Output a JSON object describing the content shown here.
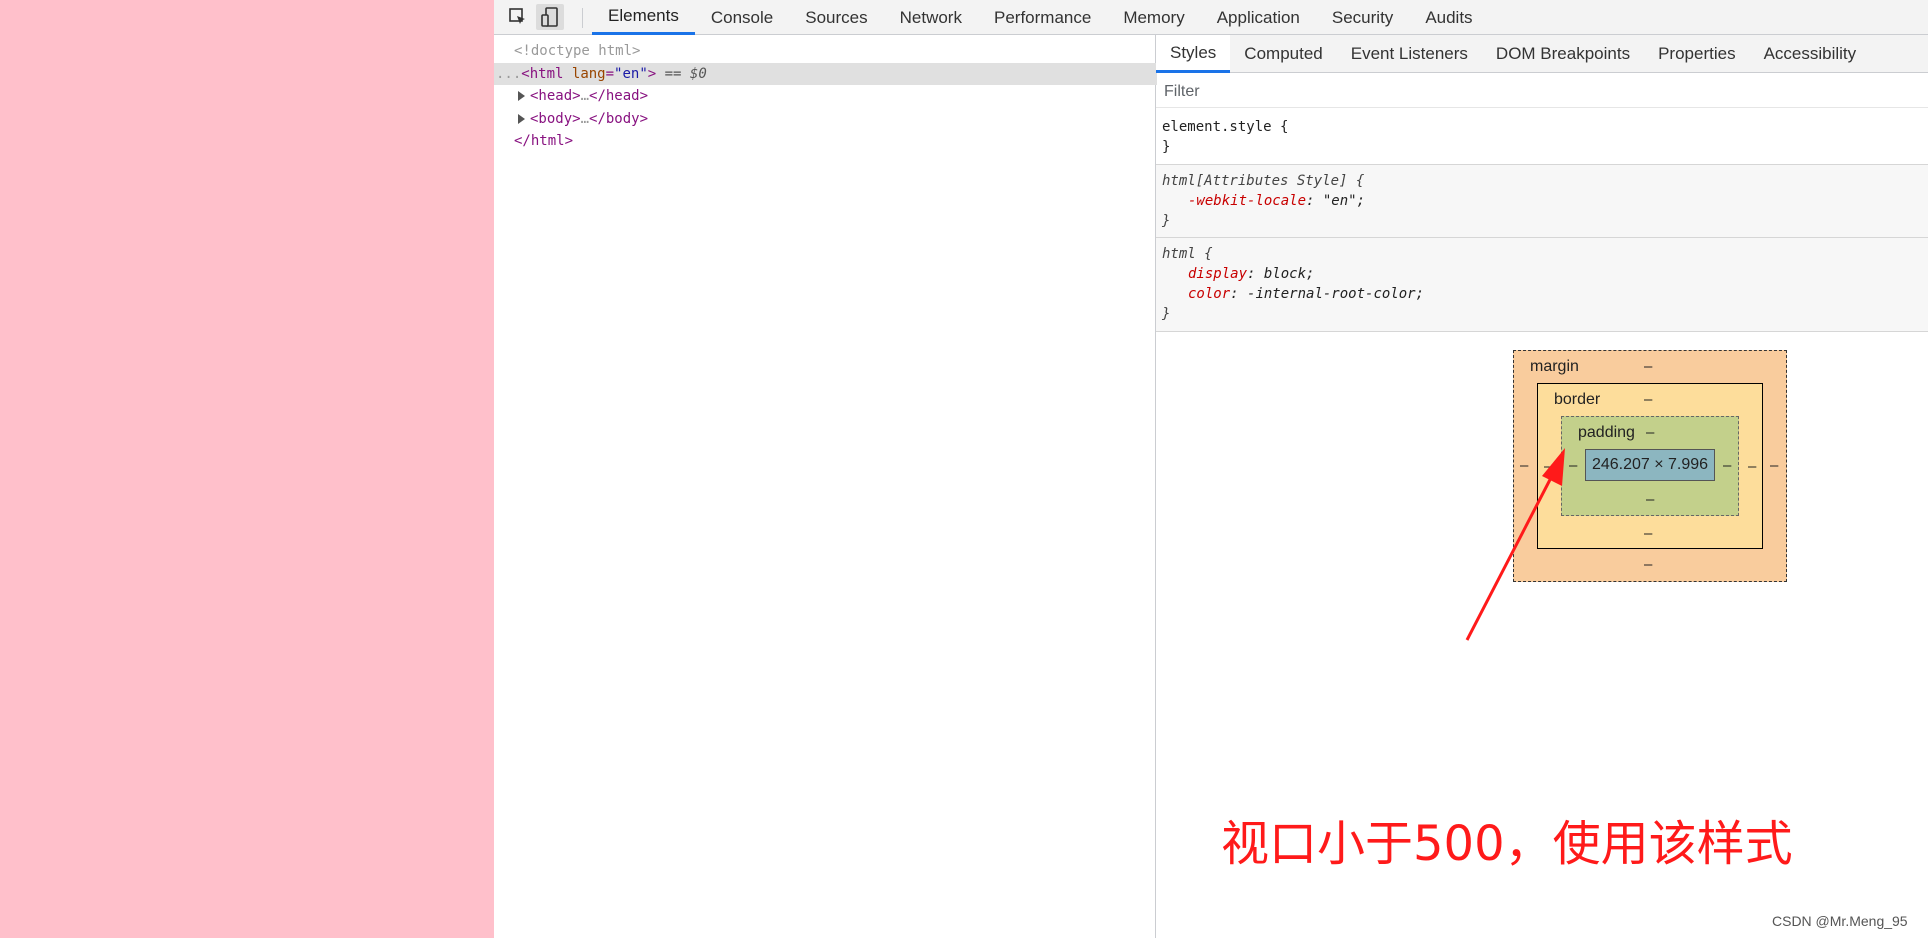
{
  "toolbar": {
    "inspect_icon": "inspect-element-icon",
    "device_icon": "device-toolbar-icon",
    "tabs": [
      {
        "label": "Elements",
        "active": true
      },
      {
        "label": "Console"
      },
      {
        "label": "Sources"
      },
      {
        "label": "Network"
      },
      {
        "label": "Performance"
      },
      {
        "label": "Memory"
      },
      {
        "label": "Application"
      },
      {
        "label": "Security"
      },
      {
        "label": "Audits"
      }
    ]
  },
  "elements": {
    "doctype": "<!doctype html>",
    "html_open_prefix": "...",
    "html_tag_open": "<html",
    "html_attr_name": "lang",
    "html_attr_eq": "=",
    "html_attr_value": "\"en\"",
    "html_tag_close": ">",
    "html_selected_marker": " == $0",
    "head_open": "<head>",
    "head_ellipsis": "…",
    "head_close": "</head>",
    "body_open": "<body>",
    "body_ellipsis": "…",
    "body_close": "</body>",
    "html_end": "</html>"
  },
  "styles": {
    "sub_tabs": [
      {
        "label": "Styles",
        "active": true
      },
      {
        "label": "Computed"
      },
      {
        "label": "Event Listeners"
      },
      {
        "label": "DOM Breakpoints"
      },
      {
        "label": "Properties"
      },
      {
        "label": "Accessibility"
      }
    ],
    "filter_placeholder": "Filter",
    "rules": {
      "element_style_open": "element.style {",
      "element_style_close": "}",
      "attr_selector": "html[Attributes Style] {",
      "attr_prop": "-webkit-locale",
      "attr_value": "\"en\";",
      "attr_close": "}",
      "html_selector": "html {",
      "prop_display": "display",
      "value_display": "block;",
      "prop_color": "color",
      "value_color": "-internal-root-color;",
      "html_close": "}"
    }
  },
  "box_model": {
    "margin_label": "margin",
    "border_label": "border",
    "padding_label": "padding",
    "dash": "–",
    "content_size": "246.207 × 7.996"
  },
  "annotation": {
    "text": "视口小于500，使用该样式",
    "color": "#ff1a1a"
  },
  "watermark": "CSDN @Mr.Meng_95",
  "colors": {
    "viewport_bg": "#ffc0cb",
    "active_tab": "#1a73e8",
    "margin": "#f9cc9d",
    "border": "#fddd9b",
    "padding": "#c3d08b",
    "content": "#8cb6c0"
  }
}
